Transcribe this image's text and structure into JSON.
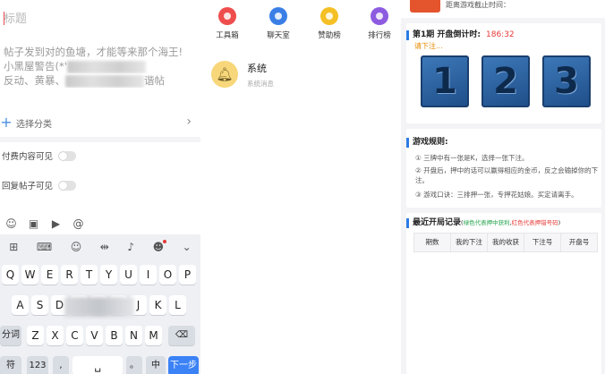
{
  "composer": {
    "title_placeholder": "标题",
    "body_line1": "帖子发到对的鱼塘，才能等来那个海王!",
    "body_line2": "小黑屋警告(*'",
    "body_line3_a": "反动、黄暴、",
    "body_line3_b": "谐帖",
    "category_label": "选择分类",
    "toggle_paid": "付费内容可见",
    "toggle_reply": "回复帖子可见",
    "tools": [
      "emoji-icon",
      "image-icon",
      "video-icon",
      "at-icon"
    ]
  },
  "keyboard": {
    "row1": [
      "Q",
      "W",
      "E",
      "R",
      "T",
      "Y",
      "U",
      "I",
      "O",
      "P"
    ],
    "row2": [
      "A",
      "S",
      "D",
      "F",
      "G",
      "H",
      "J",
      "K",
      "L"
    ],
    "row3": [
      "Z",
      "X",
      "C",
      "V",
      "B",
      "N",
      "M"
    ],
    "fn_left": "分词",
    "sym": "符",
    "num": "123",
    "lang": "中",
    "next": "下一步"
  },
  "features": [
    {
      "label": "工具箱",
      "color": "#ef4d4d"
    },
    {
      "label": "聊天室",
      "color": "#3b7fe6"
    },
    {
      "label": "赞助榜",
      "color": "#f5c025"
    },
    {
      "label": "排行榜",
      "color": "#8d5be0"
    }
  ],
  "message": {
    "title": "系统",
    "subtitle": "系统消息"
  },
  "game": {
    "header_text": "距离游戏截止时间：",
    "period_title": "第1期  开盘倒计时:",
    "countdown": "186:32",
    "pending": "请下注...",
    "numbers": [
      "1",
      "2",
      "3"
    ],
    "rules_title": "游戏规则:",
    "rules": [
      "① 三牌中有一张是K，选择一张下注。",
      "② 开盘后，押中的话可以赢得相应的金币，反之会输掉你的下注。",
      "③ 游戏口诀：三排押一张，专押花姑娘。买定请离手。"
    ],
    "history_title": "最近开局记录",
    "history_note_open": "(",
    "history_note_green": "绿色代表押中获利",
    "history_note_sep": ",",
    "history_note_red": "红色代表押错号码",
    "history_note_close": ")",
    "columns": [
      "期数",
      "我的下注",
      "我的收获",
      "下注号",
      "开盘号"
    ]
  }
}
